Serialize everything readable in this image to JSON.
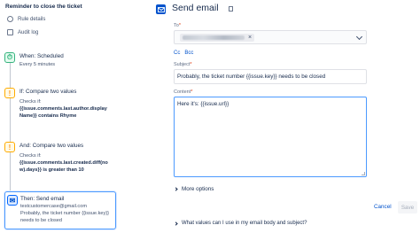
{
  "rule": {
    "title": "Reminder to close the ticket",
    "nav": [
      {
        "label": "Rule details",
        "icon": "gear-icon"
      },
      {
        "label": "Audit log",
        "icon": "document-icon"
      }
    ],
    "steps": [
      {
        "kind": "trigger",
        "badge": "⏱",
        "title": "When: Scheduled",
        "lines": [
          "Every 5 minutes"
        ]
      },
      {
        "kind": "condition",
        "badge": "!",
        "title": "If: Compare two values",
        "lines": [
          "Checks if:",
          "{{issue.comments.last.author.display",
          "Name}} contains Rhyme"
        ]
      },
      {
        "kind": "condition",
        "badge": "!",
        "title": "And: Compare two values",
        "lines": [
          "Checks if:",
          "{{issue.comments.last.created.diff(no",
          "w).days}} is greater than 10"
        ]
      },
      {
        "kind": "action",
        "badge": "✉",
        "title": "Then: Send email",
        "lines": [
          "testcustomercase@gmail.com",
          "Probably, the ticket number {{issue.key}}",
          "needs to be closed"
        ]
      }
    ]
  },
  "editor": {
    "title": "Send email",
    "to_label": "To",
    "required_mark": "*",
    "cc_label": "Cc",
    "bcc_label": "Bcc",
    "subject_label": "Subject",
    "subject_value": "Probably, the ticket number {{issue.key}} needs to be closed",
    "content_label": "Content",
    "content_value": "Here it's: {{issue.url}}",
    "more_options": "More options",
    "cancel": "Cancel",
    "save": "Save",
    "faq": "What values can I use in my email body and subject?"
  },
  "colors": {
    "accent": "#0052cc",
    "trigger": "#36b37e",
    "condition": "#ffab00",
    "action_selected": "#4c9aff"
  }
}
